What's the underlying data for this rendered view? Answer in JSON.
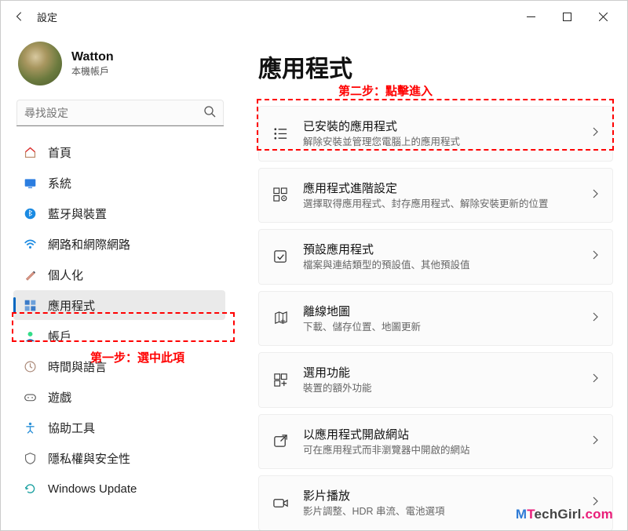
{
  "window": {
    "title": "設定"
  },
  "profile": {
    "name": "Watton",
    "sub": "本機帳戶"
  },
  "search": {
    "placeholder": "尋找設定"
  },
  "sidebar": {
    "items": [
      {
        "label": "首頁"
      },
      {
        "label": "系統"
      },
      {
        "label": "藍牙與裝置"
      },
      {
        "label": "網路和網際網路"
      },
      {
        "label": "個人化"
      },
      {
        "label": "應用程式"
      },
      {
        "label": "帳戶"
      },
      {
        "label": "時間與語言"
      },
      {
        "label": "遊戲"
      },
      {
        "label": "協助工具"
      },
      {
        "label": "隱私權與安全性"
      },
      {
        "label": "Windows Update"
      }
    ],
    "selected_index": 5
  },
  "annotations": {
    "step1": "第一步：選中此項",
    "step2": "第二步：點擊進入"
  },
  "page": {
    "title": "應用程式",
    "cards": [
      {
        "title": "已安裝的應用程式",
        "sub": "解除安裝並管理您電腦上的應用程式"
      },
      {
        "title": "應用程式進階設定",
        "sub": "選擇取得應用程式、封存應用程式、解除安裝更新的位置"
      },
      {
        "title": "預設應用程式",
        "sub": "檔案與連結類型的預設值、其他預設值"
      },
      {
        "title": "離線地圖",
        "sub": "下載、儲存位置、地圖更新"
      },
      {
        "title": "選用功能",
        "sub": "裝置的額外功能"
      },
      {
        "title": "以應用程式開啟網站",
        "sub": "可在應用程式而非瀏覽器中開啟的網站"
      },
      {
        "title": "影片播放",
        "sub": "影片調整、HDR 串流、電池選項"
      }
    ]
  },
  "watermark": {
    "a": "M",
    "b": "T",
    "c": "echGirl",
    "d": ".com"
  }
}
